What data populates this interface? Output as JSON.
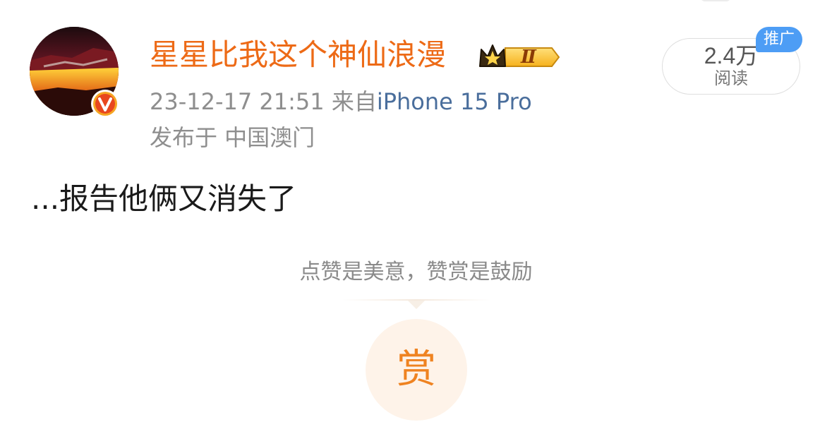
{
  "post": {
    "username": "星星比我这个神仙浪漫",
    "timestamp": "23-12-17 21:51",
    "source_prefix": "来自",
    "device": "iPhone 15 Pro",
    "location": "发布于 中国澳门",
    "text": "...报告他俩又消失了",
    "vip_level": "Ⅱ"
  },
  "stats": {
    "reads_count": "2.4万",
    "reads_label": "阅读",
    "promo_label": "推广"
  },
  "reward": {
    "caption": "点赞是美意，赞赏是鼓励",
    "button_label": "赏"
  },
  "icons": {
    "avatar": "avatar-image",
    "verified": "verified-v-icon",
    "vip": "vip-crown-icon"
  },
  "colors": {
    "username": "#ed6a16",
    "device_link": "#4a6e9c",
    "meta": "#8e8e8e",
    "promo": "#4d9df5",
    "reward_accent": "#ef8321",
    "reward_bg": "#fef3e9"
  }
}
